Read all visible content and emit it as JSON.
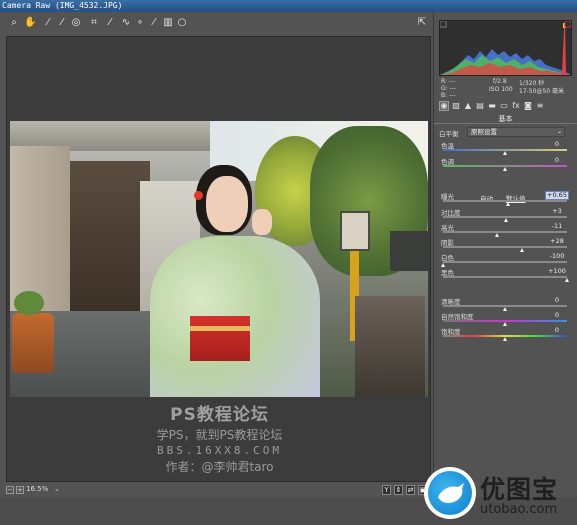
{
  "window": {
    "title": "Camera Raw (IMG_4532.JPG)"
  },
  "toolbar": {
    "tools": [
      "zoom-icon",
      "hand-icon",
      "white-balance-icon",
      "color-sampler-icon",
      "target-adjust-icon",
      "crop-icon",
      "straighten-icon",
      "spot-removal-icon",
      "red-eye-icon",
      "adjustment-brush-icon",
      "graduated-filter-icon",
      "radial-filter-icon"
    ],
    "right_tool": "preferences-icon"
  },
  "watermark": {
    "line1": "PS教程论坛",
    "line2": "学PS，就到PS教程论坛",
    "line3": "BBS.16XX8.COM",
    "line4": "作者：@李帅君taro"
  },
  "status": {
    "zoom": "16.5%"
  },
  "info": {
    "r": "R: ---",
    "g": "G: ---",
    "b": "B: ---",
    "aperture": "f/2.8",
    "shutter": "1/320 秒",
    "iso": "ISO 100",
    "lens": "17-50@50 毫米"
  },
  "panel": {
    "section_title": "基本",
    "wb_label": "白平衡",
    "wb_value": "原照设置",
    "auto_label": "自动",
    "default_label": "默认值",
    "sliders": [
      {
        "label": "色温",
        "value": "0",
        "level": 0.5
      },
      {
        "label": "色调",
        "value": "0",
        "level": 0.5
      },
      {
        "label": "曝光",
        "value": "+0.65",
        "level": 0.53
      },
      {
        "label": "对比度",
        "value": "+3",
        "level": 0.51
      },
      {
        "label": "高光",
        "value": "-11",
        "level": 0.44
      },
      {
        "label": "阴影",
        "value": "+28",
        "level": 0.64
      },
      {
        "label": "白色",
        "value": "-100",
        "level": 0.0
      },
      {
        "label": "黑色",
        "value": "+100",
        "level": 1.0
      },
      {
        "label": "清晰度",
        "value": "0",
        "level": 0.5
      },
      {
        "label": "自然饱和度",
        "value": "0",
        "level": 0.5
      },
      {
        "label": "饱和度",
        "value": "0",
        "level": 0.5
      }
    ]
  },
  "logo": {
    "cn": "优图宝",
    "url": "utobao.com"
  },
  "colors": {
    "accent": "#1a8fd6",
    "panel": "#535353",
    "title": "#3a6ea5"
  }
}
